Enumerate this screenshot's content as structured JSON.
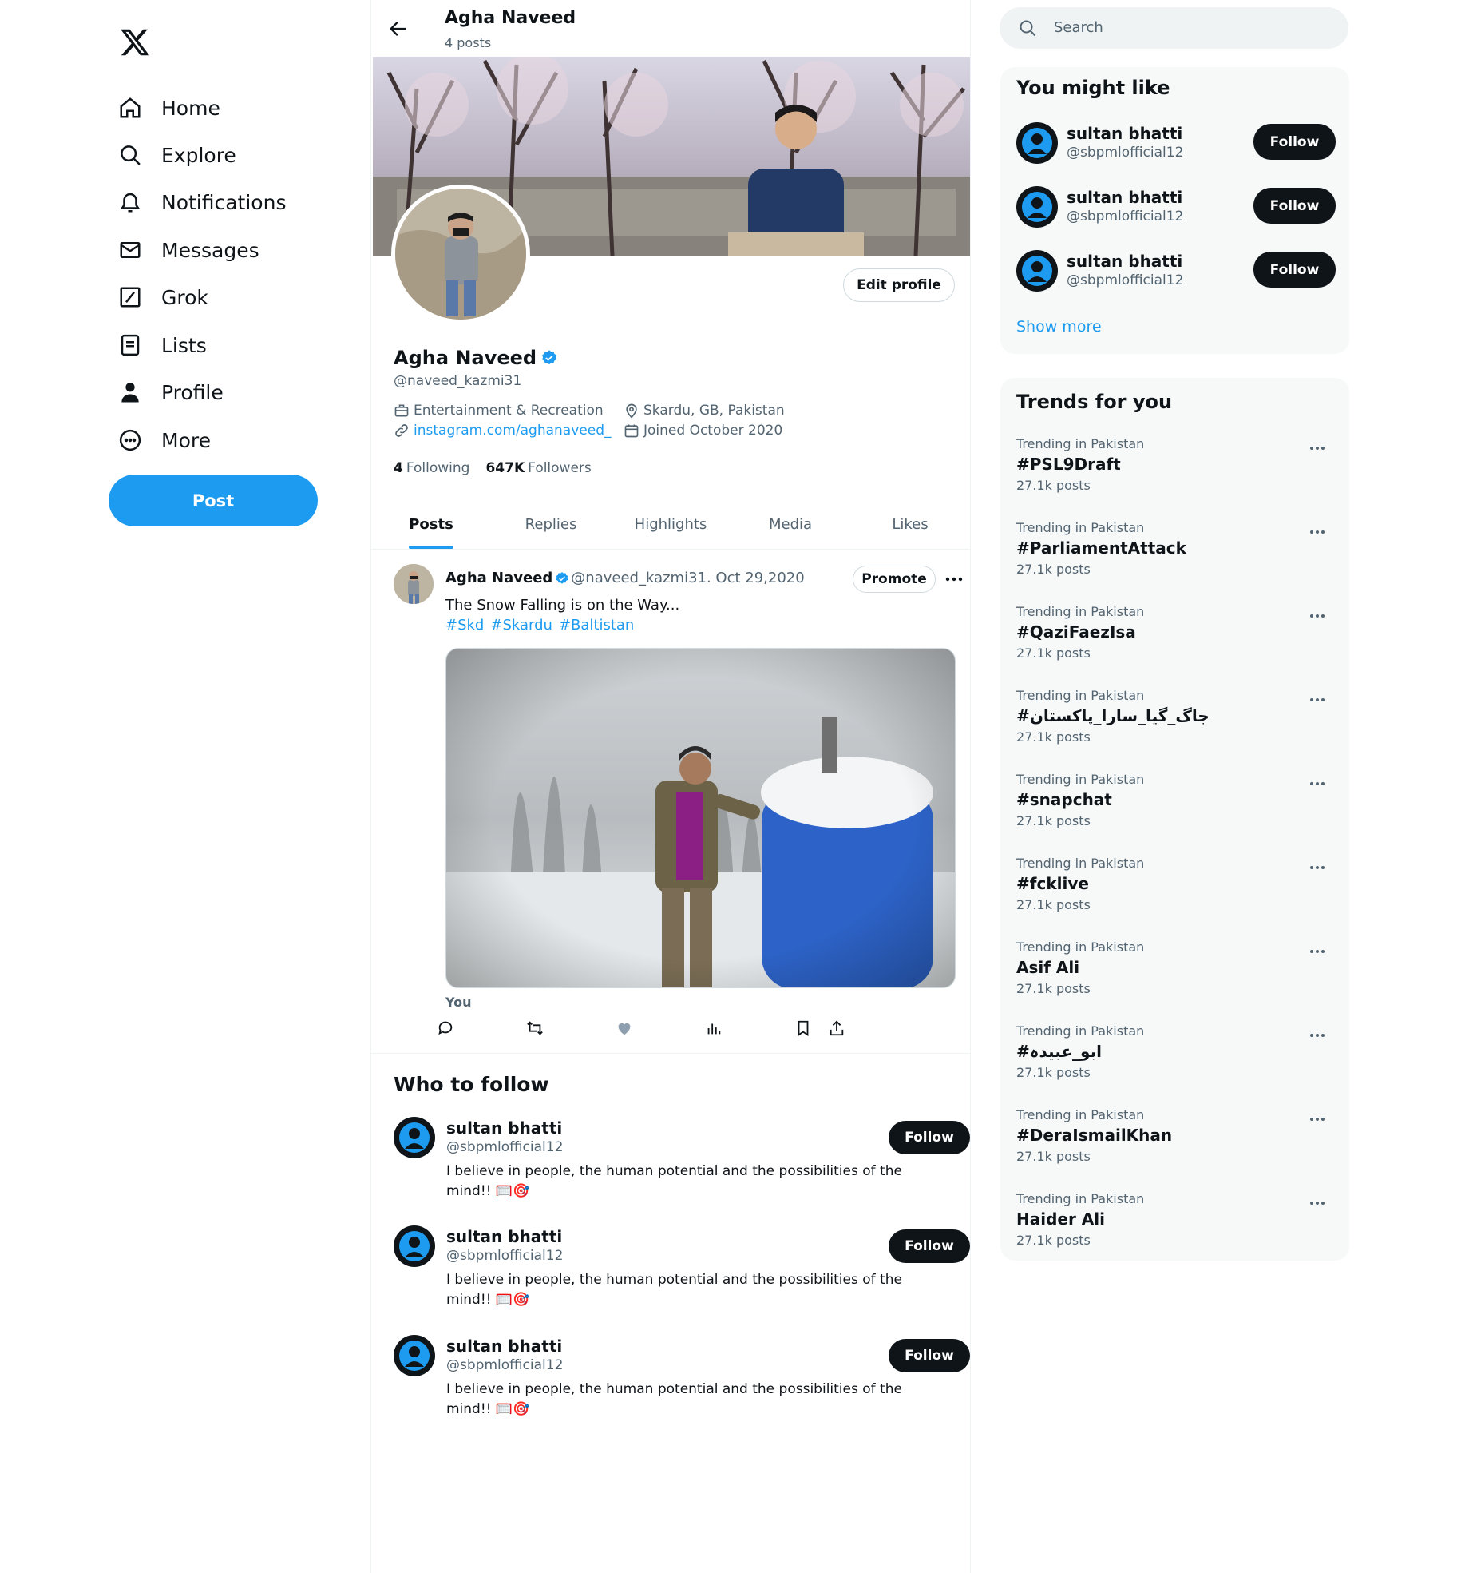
{
  "nav": {
    "items": [
      {
        "label": "Home",
        "icon": "home-icon"
      },
      {
        "label": "Explore",
        "icon": "search-icon"
      },
      {
        "label": "Notifications",
        "icon": "bell-icon"
      },
      {
        "label": "Messages",
        "icon": "mail-icon"
      },
      {
        "label": "Grok",
        "icon": "grok-icon"
      },
      {
        "label": "Lists",
        "icon": "list-icon"
      },
      {
        "label": "Profile",
        "icon": "person-icon"
      },
      {
        "label": "More",
        "icon": "more-circle-icon"
      }
    ],
    "post_label": "Post"
  },
  "header": {
    "title": "Agha Naveed",
    "subtitle": "4 posts"
  },
  "profile": {
    "name": "Agha Naveed",
    "handle": "@naveed_kazmi31",
    "edit_label": "Edit profile",
    "category": "Entertainment & Recreation",
    "location": "Skardu, GB, Pakistan",
    "website": "instagram.com/aghanaveed_",
    "joined": "Joined October 2020",
    "following_count": "4",
    "following_label": "Following",
    "followers_count": "647K",
    "followers_label": "Followers"
  },
  "tabs": [
    "Posts",
    "Replies",
    "Highlights",
    "Media",
    "Likes"
  ],
  "post": {
    "author": "Agha Naveed",
    "handle_date": "@naveed_kazmi31. Oct 29,2020",
    "promote_label": "Promote",
    "text": "The Snow Falling is on the Way...",
    "tags": [
      "#Skd",
      "#Skardu",
      "#Baltistan"
    ],
    "footer_label": "You"
  },
  "who_to_follow": {
    "title": "Who to follow",
    "items": [
      {
        "name": "sultan bhatti",
        "handle": "@sbpmlofficial12",
        "bio": "I believe in people, the human potential and the possibilities of the mind!! 🥅🎯",
        "follow_label": "Follow"
      },
      {
        "name": "sultan bhatti",
        "handle": "@sbpmlofficial12",
        "bio": "I believe in people, the human potential and the possibilities of the mind!! 🥅🎯",
        "follow_label": "Follow"
      },
      {
        "name": "sultan bhatti",
        "handle": "@sbpmlofficial12",
        "bio": "I believe in people, the human potential and the possibilities of the mind!! 🥅🎯",
        "follow_label": "Follow"
      }
    ]
  },
  "search": {
    "placeholder": "Search"
  },
  "you_might_like": {
    "title": "You might like",
    "items": [
      {
        "name": "sultan bhatti",
        "handle": "@sbpmlofficial12",
        "follow_label": "Follow"
      },
      {
        "name": "sultan bhatti",
        "handle": "@sbpmlofficial12",
        "follow_label": "Follow"
      },
      {
        "name": "sultan bhatti",
        "handle": "@sbpmlofficial12",
        "follow_label": "Follow"
      }
    ],
    "show_more": "Show more"
  },
  "trends": {
    "title": "Trends for you",
    "items": [
      {
        "context": "Trending in Pakistan",
        "name": "#PSL9Draft",
        "posts": "27.1k posts"
      },
      {
        "context": "Trending in Pakistan",
        "name": "#ParliamentAttack",
        "posts": "27.1k posts"
      },
      {
        "context": "Trending in Pakistan",
        "name": "#QaziFaezIsa",
        "posts": "27.1k posts"
      },
      {
        "context": "Trending in Pakistan",
        "name": "#جاگ_گیا_سارا_پاکستان",
        "posts": "27.1k posts"
      },
      {
        "context": "Trending in Pakistan",
        "name": "#snapchat",
        "posts": "27.1k posts"
      },
      {
        "context": "Trending in Pakistan",
        "name": "#fcklive",
        "posts": "27.1k posts"
      },
      {
        "context": "Trending in Pakistan",
        "name": "Asif Ali",
        "posts": "27.1k posts"
      },
      {
        "context": "Trending in Pakistan",
        "name": "#ابو_عبیدہ",
        "posts": "27.1k posts"
      },
      {
        "context": "Trending in Pakistan",
        "name": "#DeraIsmailKhan",
        "posts": "27.1k posts"
      },
      {
        "context": "Trending in Pakistan",
        "name": "Haider Ali",
        "posts": "27.1k posts"
      }
    ]
  },
  "colors": {
    "accent": "#1d9bf0",
    "text": "#0f1419",
    "muted": "#536471",
    "card_bg": "#f7f9f9"
  }
}
